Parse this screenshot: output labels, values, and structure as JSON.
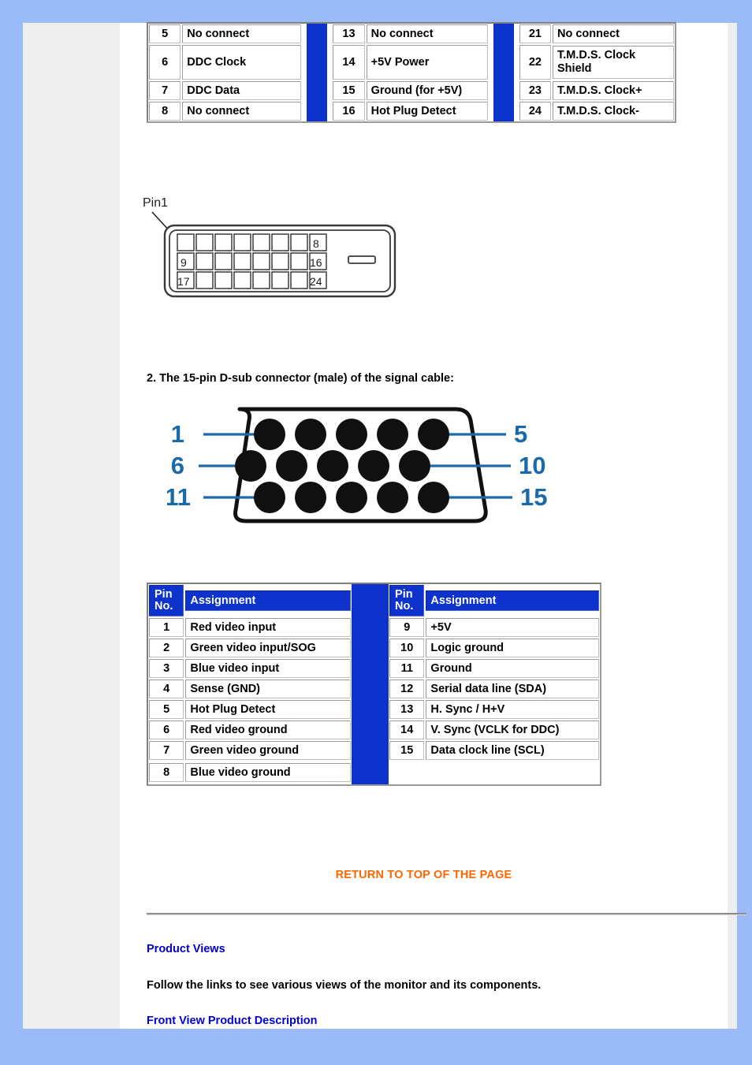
{
  "colors": {
    "page_background": "#9abbf7",
    "content_background": "#ffffff",
    "rail_background": "#eeeeee",
    "table_header_blue": "#0d33cc",
    "separator_blue": "#0d33cc",
    "link_blue": "#0000d4",
    "return_link_orange": "#ff6600",
    "diagram_label_blue": "#1a69ab"
  },
  "dvi_table": {
    "columns": [
      {
        "rows": [
          {
            "pin": "5",
            "assignment": "No connect"
          },
          {
            "pin": "6",
            "assignment": "DDC Clock"
          },
          {
            "pin": "7",
            "assignment": "DDC Data"
          },
          {
            "pin": "8",
            "assignment": "No connect"
          }
        ]
      },
      {
        "rows": [
          {
            "pin": "13",
            "assignment": "No connect"
          },
          {
            "pin": "14",
            "assignment": "+5V Power"
          },
          {
            "pin": "15",
            "assignment": "Ground (for +5V)"
          },
          {
            "pin": "16",
            "assignment": "Hot Plug Detect"
          }
        ]
      },
      {
        "rows": [
          {
            "pin": "21",
            "assignment": "No connect"
          },
          {
            "pin": "22",
            "assignment": "T.M.D.S. Clock Shield"
          },
          {
            "pin": "23",
            "assignment": "T.M.D.S. Clock+"
          },
          {
            "pin": "24",
            "assignment": "T.M.D.S. Clock-"
          }
        ]
      }
    ]
  },
  "dvi_figure": {
    "callout_label": "Pin1",
    "row_end_labels": [
      "8",
      "16",
      "24"
    ],
    "row_start_labels": [
      "",
      "9",
      "17"
    ],
    "pins_per_row": 8,
    "rows": 3
  },
  "dsub_heading": "2. The 15-pin D-sub connector (male) of the signal cable:",
  "dsub_figure": {
    "left_labels": [
      "1",
      "6",
      "11"
    ],
    "right_labels": [
      "5",
      "10",
      "15"
    ],
    "rows": 3,
    "pins_per_row": 5
  },
  "dsub_table": {
    "header": {
      "pin_no": "Pin No.",
      "assignment": "Assignment"
    },
    "left_rows": [
      {
        "pin": "1",
        "assignment": "Red video input"
      },
      {
        "pin": "2",
        "assignment": "Green video input/SOG"
      },
      {
        "pin": "3",
        "assignment": "Blue video input"
      },
      {
        "pin": "4",
        "assignment": "Sense (GND)"
      },
      {
        "pin": "5",
        "assignment": "Hot Plug Detect"
      },
      {
        "pin": "6",
        "assignment": "Red video ground"
      },
      {
        "pin": "7",
        "assignment": "Green video ground"
      },
      {
        "pin": "8",
        "assignment": "Blue video ground"
      }
    ],
    "right_rows": [
      {
        "pin": "9",
        "assignment": "+5V"
      },
      {
        "pin": "10",
        "assignment": "Logic ground"
      },
      {
        "pin": "11",
        "assignment": "Ground"
      },
      {
        "pin": "12",
        "assignment": "Serial data line (SDA)"
      },
      {
        "pin": "13",
        "assignment": "H. Sync / H+V"
      },
      {
        "pin": "14",
        "assignment": "V. Sync (VCLK for DDC)"
      },
      {
        "pin": "15",
        "assignment": "Data clock line (SCL)"
      }
    ]
  },
  "footer": {
    "return_to_top": "RETURN TO TOP OF THE PAGE",
    "product_views_heading": "Product Views",
    "product_views_text": "Follow the links to see various views of the monitor and its components.",
    "front_view_link": "Front View Product Description"
  }
}
